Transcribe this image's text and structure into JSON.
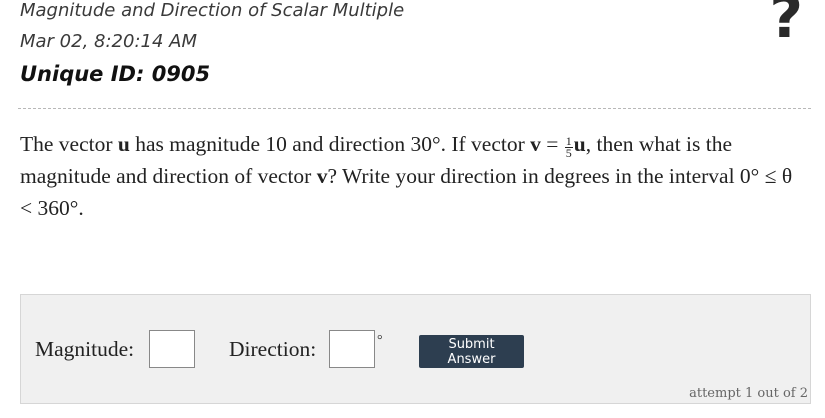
{
  "header": {
    "title": "Magnitude and Direction of Scalar Multiple",
    "date": "Mar 02, 8:20:14 AM",
    "unique_id": "Unique ID: 0905",
    "help_glyph": "?"
  },
  "question": {
    "p1": "The vector ",
    "u": "u",
    "p2": " has magnitude 10 and direction 30°. If vector ",
    "v": "v",
    "p3": " = ",
    "frac_num": "1",
    "frac_den": "5",
    "u2": "u",
    "p4": ", then what is the magnitude and direction of vector ",
    "v2": "v",
    "p5": "? Write your direction in degrees in the interval 0° ≤ θ < 360°."
  },
  "answer": {
    "magnitude_label": "Magnitude:",
    "direction_label": "Direction:",
    "degree_symbol": "°",
    "magnitude_value": "",
    "direction_value": "",
    "submit_label": "Submit Answer",
    "attempt_text": "attempt 1 out of 2"
  }
}
